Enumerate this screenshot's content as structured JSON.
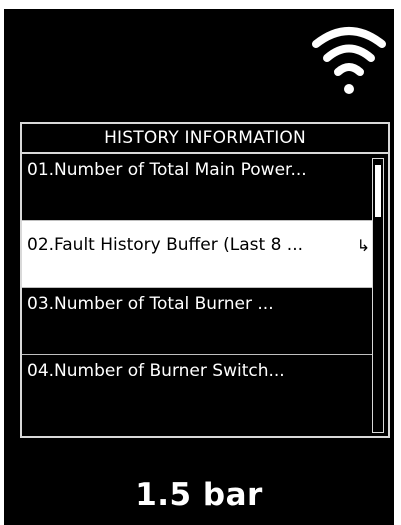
{
  "panel": {
    "title": "HISTORY INFORMATION",
    "items": [
      {
        "label": "01.Number of Total Main Power..."
      },
      {
        "label": "02.Fault History Buffer (Last 8 ...",
        "enter_glyph": "↳",
        "selected": true
      },
      {
        "label": "03.Number of Total Burner ..."
      },
      {
        "label": "04.Number of Burner Switch..."
      }
    ]
  },
  "status": {
    "pressure": "1.5 bar",
    "connectivity_icon": "wifi-icon"
  },
  "colors": {
    "background": "#000000",
    "foreground": "#ffffff",
    "selected_bg": "#ffffff",
    "selected_fg": "#000000"
  }
}
